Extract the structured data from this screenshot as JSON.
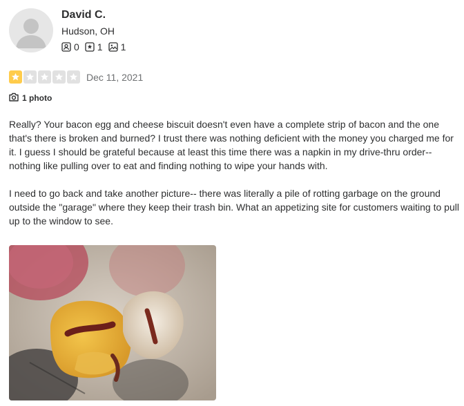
{
  "user": {
    "name": "David C.",
    "location": "Hudson, OH",
    "stats": {
      "friends": "0",
      "reviews": "1",
      "photos": "1"
    },
    "icons": {
      "friends": "friends-icon",
      "reviews": "reviews-icon",
      "photos": "photos-icon"
    }
  },
  "review": {
    "rating": 1,
    "max_rating": 5,
    "date": "Dec 11, 2021",
    "photo_count_label": "1 photo",
    "paragraphs": [
      "Really? Your bacon egg and cheese biscuit doesn't even have a complete strip of bacon and the one that's there is broken and burned? I trust there was nothing deficient with the money you charged me for it. I guess I should be grateful because at least this time there was a napkin in my drive-thru order-- nothing like pulling over to eat and finding nothing to wipe your hands with.",
      "I need to go back and take another picture-- there was literally a pile of rotting garbage on the ground outside the \"garage\" where they keep their trash bin. What an appetizing site for customers waiting to pull up to the window to see."
    ]
  },
  "colors": {
    "star_filled": "#ffcc4b",
    "star_empty": "#e1e1e1",
    "text": "#2d2e2f",
    "muted": "#6e7072"
  }
}
